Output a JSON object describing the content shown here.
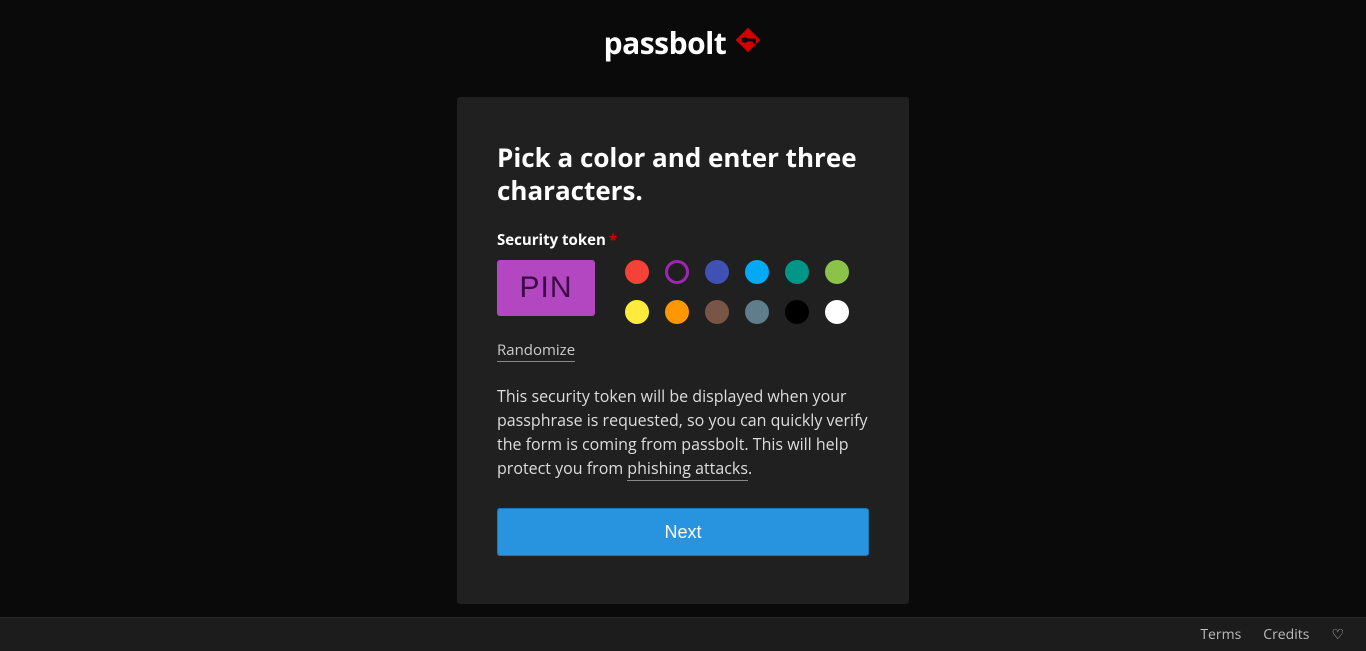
{
  "brand": {
    "name": "passbolt"
  },
  "card": {
    "title": "Pick a color and enter three characters.",
    "label": "Security token",
    "required_mark": "*",
    "token_value": "PIN",
    "randomize": "Randomize",
    "desc_1": "This security token will be displayed when your passphrase is requested, so you can quickly verify the form is coming from passbolt. This will help protect you from ",
    "phishing_link": "phishing attacks",
    "desc_2": ".",
    "next": "Next"
  },
  "colors": {
    "selected": "#9c27b0",
    "token_bg": "#b346c1",
    "token_fg": "#3c0a45",
    "list": [
      "#f44336",
      "#9c27b0",
      "#3f51b5",
      "#03a9f4",
      "#009688",
      "#8bc34a",
      "#ffeb3b",
      "#ff9800",
      "#795548",
      "#607d8b",
      "#000000",
      "#ffffff"
    ]
  },
  "footer": {
    "terms": "Terms",
    "credits": "Credits"
  }
}
